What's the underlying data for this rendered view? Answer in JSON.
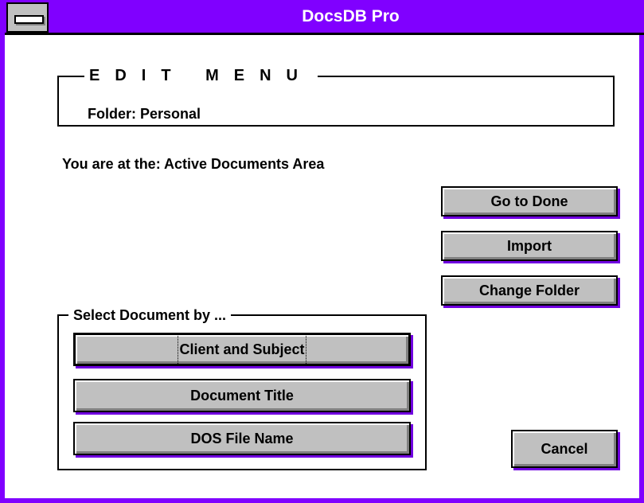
{
  "window": {
    "title": "DocsDB Pro"
  },
  "edit_box": {
    "legend": "EDIT MENU",
    "folder": "Folder: Personal"
  },
  "location_text": "You are at the:  Active Documents Area",
  "actions": {
    "go_to_done": "Go to Done",
    "import": "Import",
    "change_folder": "Change Folder"
  },
  "select_group": {
    "legend": "Select Document by ...",
    "client_subject": "Client and Subject",
    "document_title": "Document Title",
    "dos_file_name": "DOS File Name"
  },
  "cancel": "Cancel",
  "colors": {
    "title_bar": "#8000ff",
    "button_face": "#c0c0c0"
  }
}
